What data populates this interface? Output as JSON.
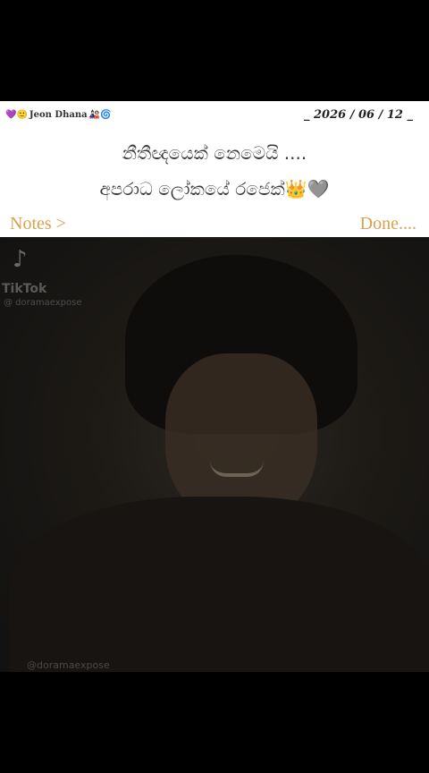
{
  "header": {
    "handle": "Jeon Dhana",
    "handle_prefix_emoji": "💜🙂",
    "handle_suffix_emoji": "🎎🌀",
    "date": "_ 2026 / 06 / 12 _"
  },
  "note": {
    "line1": "නීතීඥයෙක් නෙමෙයි ....",
    "line2": "අපරාධ ලෝකයේ රජෙක්",
    "line2_crown": "👑",
    "line2_heart": "🩶"
  },
  "nav": {
    "notes_label": "Notes >",
    "done_label": "Done...."
  },
  "video": {
    "tiktok_label": "TikTok",
    "tiktok_handle": "@ doramaexpose",
    "bottom_watermark": "@doramaexpose"
  },
  "colors": {
    "accent": "#d8a24f",
    "panel_bg": "#ffffff",
    "backdrop": "#000000"
  }
}
